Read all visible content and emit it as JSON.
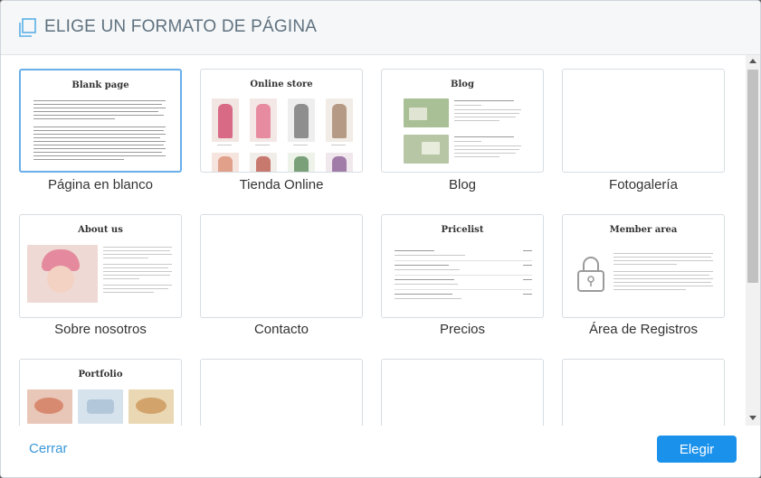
{
  "dialog": {
    "title": "ELIGE UN FORMATO DE PÁGINA",
    "title_icon": "copy-pages-icon"
  },
  "templates": [
    {
      "label": "Página en blanco",
      "thumb_title": "Blank page",
      "selected": true
    },
    {
      "label": "Tienda Online",
      "thumb_title": "Online store",
      "selected": false
    },
    {
      "label": "Blog",
      "thumb_title": "Blog",
      "selected": false
    },
    {
      "label": "Fotogalería",
      "thumb_title": "",
      "selected": false
    },
    {
      "label": "Sobre nosotros",
      "thumb_title": "About us",
      "selected": false
    },
    {
      "label": "Contacto",
      "thumb_title": "",
      "selected": false
    },
    {
      "label": "Precios",
      "thumb_title": "Pricelist",
      "selected": false
    },
    {
      "label": "Área de Registros",
      "thumb_title": "Member area",
      "selected": false
    },
    {
      "label": "",
      "thumb_title": "Portfolio",
      "selected": false
    },
    {
      "label": "",
      "thumb_title": "",
      "selected": false
    },
    {
      "label": "",
      "thumb_title": "",
      "selected": false
    },
    {
      "label": "",
      "thumb_title": "",
      "selected": false
    }
  ],
  "footer": {
    "close_label": "Cerrar",
    "choose_label": "Elegir"
  },
  "colors": {
    "accent": "#1a91eb",
    "link": "#3a98d8",
    "selected_border": "#6aaeea",
    "title_text": "#5f7280"
  }
}
